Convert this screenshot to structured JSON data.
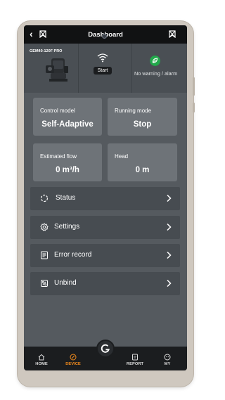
{
  "header": {
    "title": "Dashboard",
    "back_icon": "chevron-left-icon",
    "left_icon": "bookmark-icon",
    "right_icon": "bookmark-icon"
  },
  "device": {
    "model": "GEM40-120F PRO",
    "connection": {
      "icon": "wifi-icon",
      "status_label": "Start"
    },
    "alarm": {
      "icon": "leaf-icon",
      "text": "No warning / alarm",
      "color": "#21a94a"
    }
  },
  "cards": [
    {
      "label": "Control model",
      "value": "Self-Adaptive"
    },
    {
      "label": "Running mode",
      "value": "Stop"
    },
    {
      "label": "Estimated flow",
      "value": "0 m³/h"
    },
    {
      "label": "Head",
      "value": "0 m"
    }
  ],
  "menu": [
    {
      "label": "Status",
      "icon": "status-icon"
    },
    {
      "label": "Settings",
      "icon": "gear-icon"
    },
    {
      "label": "Error record",
      "icon": "document-icon"
    },
    {
      "label": "Unbind",
      "icon": "unlink-icon"
    }
  ],
  "nav": [
    {
      "label": "HOME",
      "icon": "home-icon",
      "active": false
    },
    {
      "label": "DEVICE",
      "icon": "device-icon",
      "active": true
    },
    {
      "label": "REPORT",
      "icon": "report-icon",
      "active": false
    },
    {
      "label": "MY",
      "icon": "user-icon",
      "active": false
    }
  ],
  "colors": {
    "accent": "#f08a1c",
    "screen_bg": "#555a5f",
    "card_bg": "#6e7378"
  }
}
